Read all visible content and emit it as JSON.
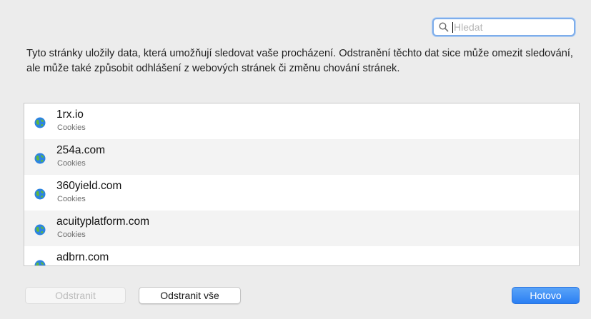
{
  "search": {
    "placeholder": "Hledat"
  },
  "description": "Tyto stránky uložily data, která umožňují sledovat vaše procházení. Odstranění těchto dat sice může omezit sledování, ale může také způsobit odhlášení z webových stránek či změnu chování stránek.",
  "sites": [
    {
      "domain": "1rx.io",
      "type": "Cookies"
    },
    {
      "domain": "254a.com",
      "type": "Cookies"
    },
    {
      "domain": "360yield.com",
      "type": "Cookies"
    },
    {
      "domain": "acuityplatform.com",
      "type": "Cookies"
    },
    {
      "domain": "adbrn.com",
      "type": ""
    }
  ],
  "buttons": {
    "remove": "Odstranit",
    "remove_all": "Odstranit vše",
    "done": "Hotovo"
  },
  "icons": {
    "search": "magnifier-icon",
    "site": "globe-icon"
  },
  "colors": {
    "accent": "#2b7ff3",
    "window_bg": "#ececec",
    "focus_ring": "#7eadea"
  },
  "state": {
    "remove_enabled": false
  }
}
